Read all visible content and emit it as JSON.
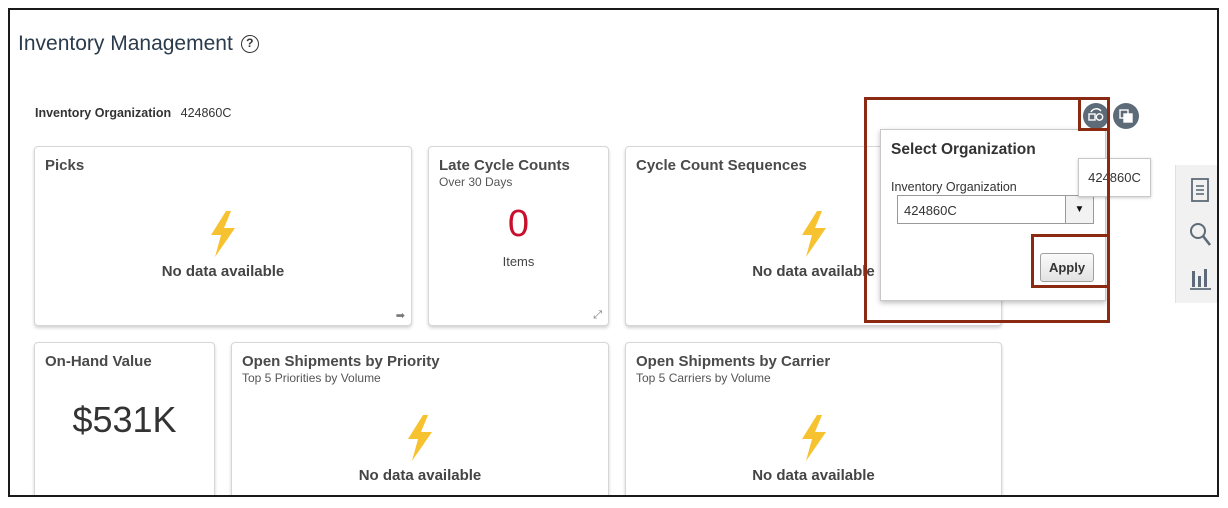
{
  "page": {
    "title": "Inventory Management",
    "org_label": "Inventory Organization",
    "org_value": "424860C"
  },
  "tiles": {
    "picks": {
      "title": "Picks",
      "status": "No data available"
    },
    "late_cycle": {
      "title": "Late Cycle Counts",
      "subtitle": "Over 30 Days",
      "value": "0",
      "unit": "Items"
    },
    "cycle_seq": {
      "title": "Cycle Count Sequences",
      "status": "No data available"
    },
    "onhand": {
      "title": "On-Hand Value",
      "value": "$531K"
    },
    "ship_priority": {
      "title": "Open Shipments by Priority",
      "subtitle": "Top 5 Priorities by Volume",
      "status": "No data available"
    },
    "ship_carrier": {
      "title": "Open Shipments by Carrier",
      "subtitle": "Top 5 Carriers by Volume",
      "status": "No data available"
    }
  },
  "popup": {
    "title": "Select Organization",
    "field_label": "Inventory Organization",
    "selected_value": "424860C",
    "apply_label": "Apply"
  },
  "tooltip": {
    "text": "424860C"
  },
  "icons": {
    "help": "help-circle-icon",
    "org_switch": "change-organization-icon",
    "copy": "copy-icon",
    "rail": [
      "document-icon",
      "search-icon",
      "bar-chart-icon"
    ]
  },
  "colors": {
    "accent_red": "#c8102e",
    "highlight_box": "#8b2a12",
    "bolt": "#f6c22f",
    "round_button": "#5d6b78"
  }
}
